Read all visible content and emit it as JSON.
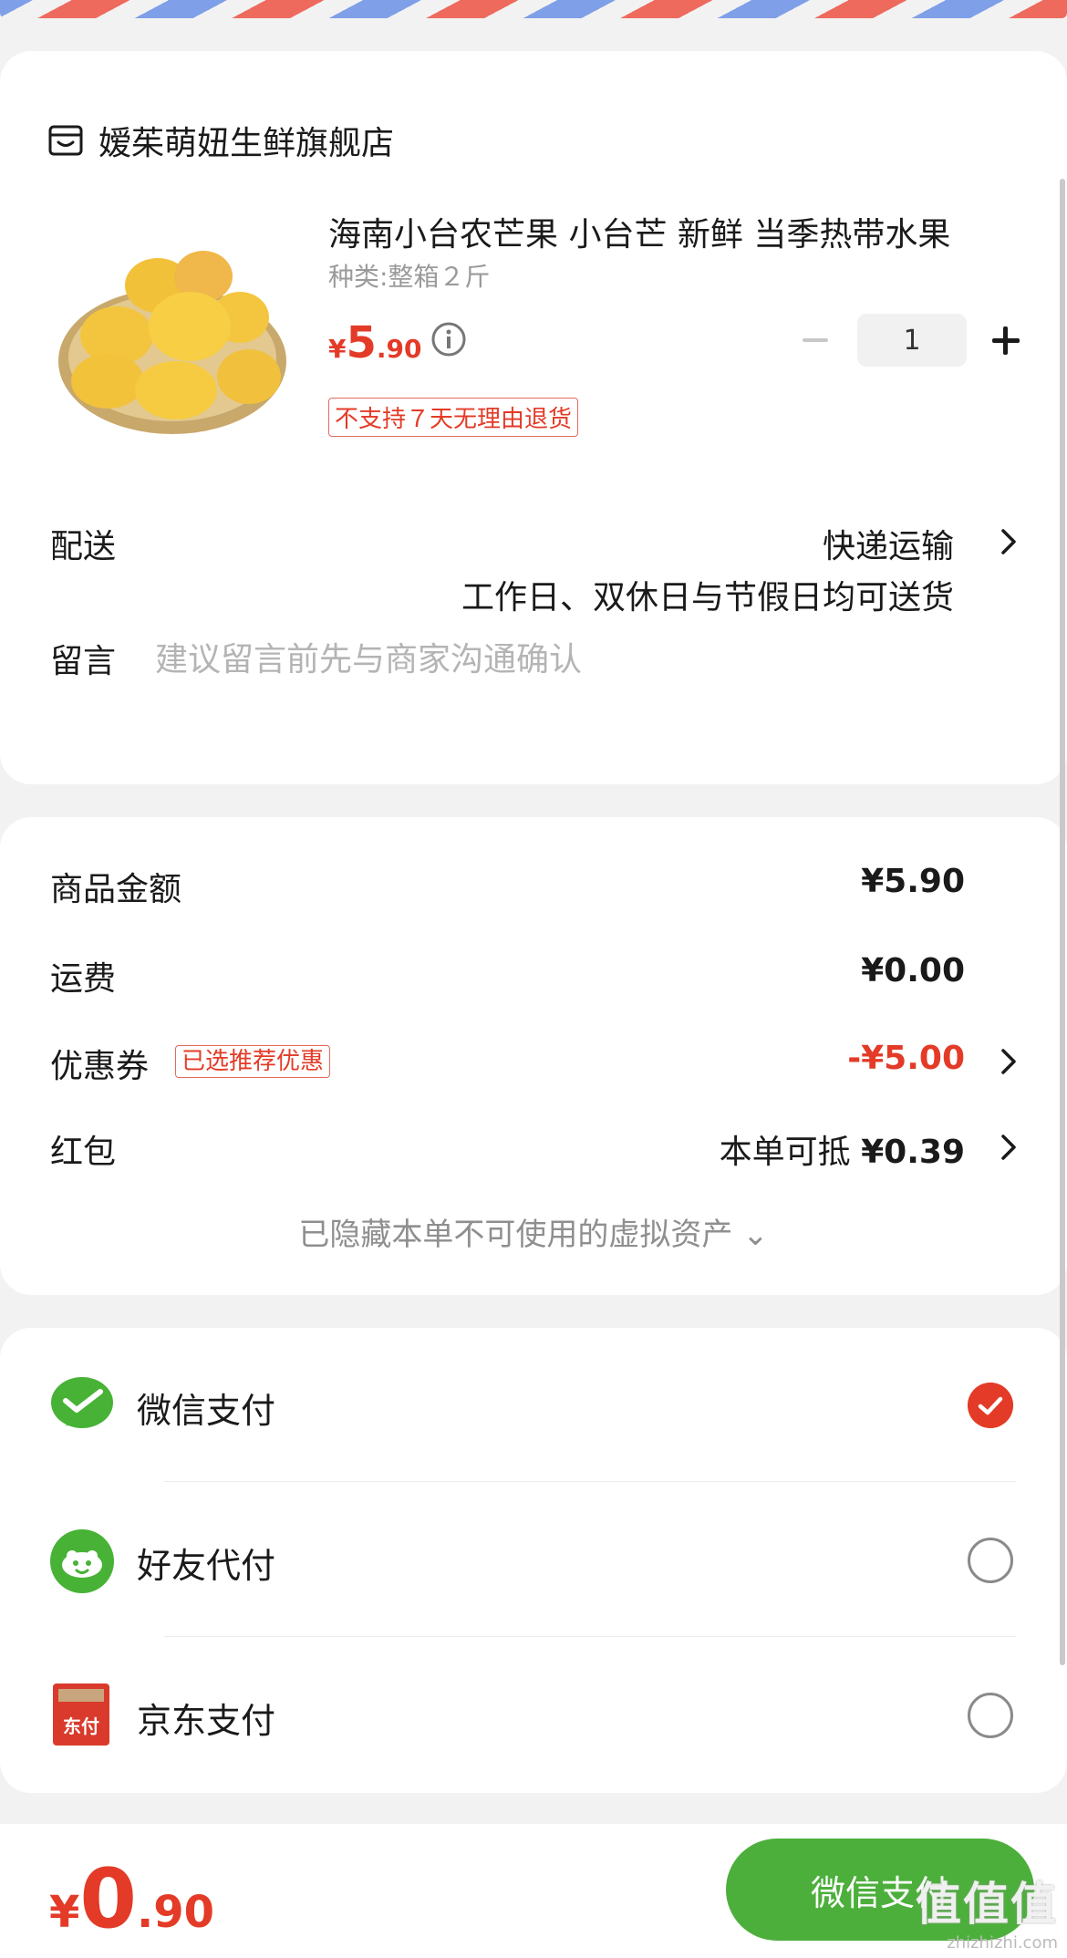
{
  "shop": {
    "name": "嫒茱萌妞生鲜旗舰店",
    "icon": "shop-icon"
  },
  "product": {
    "title": "海南小台农芒果 小台芒 新鲜 当季热带水果",
    "spec": "种类:整箱２斤",
    "price_currency": "¥",
    "price_int": "5",
    "price_dec": ".90",
    "quantity": "1",
    "return_policy": "不支持７天无理由退货"
  },
  "delivery": {
    "label": "配送",
    "method": "快递运输",
    "note": "工作日、双休日与节假日均可送货"
  },
  "message": {
    "label": "留言",
    "placeholder": "建议留言前先与商家沟通确认"
  },
  "summary": {
    "goods_label": "商品金额",
    "goods_amount": "¥5.90",
    "shipping_label": "运费",
    "shipping_amount": "¥0.00",
    "coupon_label": "优惠券",
    "coupon_tag": "已选推荐优惠",
    "coupon_amount": "-¥5.00",
    "hongbao_label": "红包",
    "hongbao_prefix": "本单可抵",
    "hongbao_amount": "¥0.39",
    "hidden_assets": "已隐藏本单不可使用的虚拟资产 ⌄"
  },
  "payment_methods": [
    {
      "label": "微信支付",
      "icon": "wechat-pay-icon",
      "selected": true
    },
    {
      "label": "好友代付",
      "icon": "friend-pay-icon",
      "selected": false
    },
    {
      "label": "京东支付",
      "icon": "jd-pay-icon",
      "icon_text": "东付",
      "selected": false
    }
  ],
  "bottom": {
    "total_currency": "¥",
    "total_int": "0",
    "total_dec": ".90",
    "pay_button": "微信支付"
  },
  "watermark": {
    "logo": "值值值",
    "url": "zhizhizhi.com"
  },
  "colors": {
    "accent_red": "#e33b27",
    "wechat_green": "#4caf3b"
  }
}
